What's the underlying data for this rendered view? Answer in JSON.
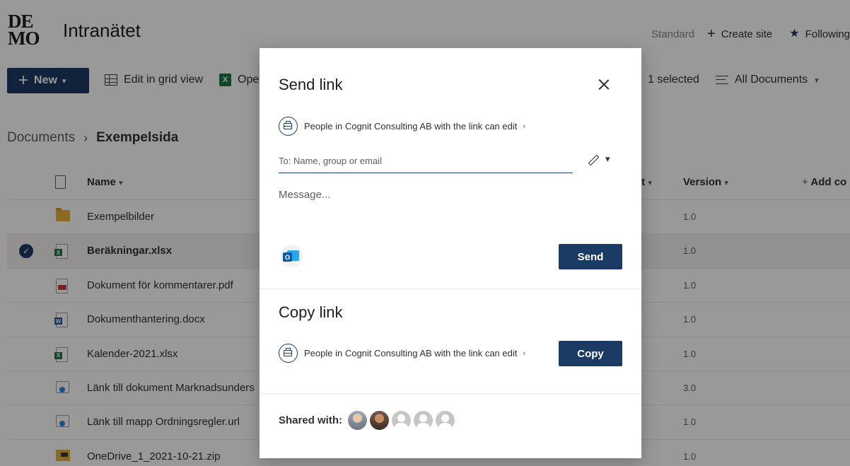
{
  "site": {
    "logo_top": "DE",
    "logo_bottom": "MO",
    "title": "Intranätet",
    "standard": "Standard",
    "create_site": "Create site",
    "following": "Following"
  },
  "commandbar": {
    "new_label": "New",
    "edit_grid": "Edit in grid view",
    "open_partial": "Open",
    "selected": "1 selected",
    "view": "All Documents"
  },
  "breadcrumb": {
    "root": "Documents",
    "current": "Exempelsida"
  },
  "columns": {
    "name": "Name",
    "modified_partial": "nt",
    "version": "Version",
    "add_column_partial": "Add co"
  },
  "rows": [
    {
      "name": "Exempelbilder",
      "version": "1.0",
      "type": "folder"
    },
    {
      "name": "Beräkningar.xlsx",
      "version": "1.0",
      "type": "xlsx",
      "selected": true
    },
    {
      "name": "Dokument för kommentarer.pdf",
      "version": "1.0",
      "type": "pdf"
    },
    {
      "name": "Dokumenthantering.docx",
      "version": "1.0",
      "type": "docx"
    },
    {
      "name": "Kalender-2021.xlsx",
      "version": "1.0",
      "type": "xlsx"
    },
    {
      "name": "Länk till dokument Marknadsunders",
      "version": "3.0",
      "type": "url"
    },
    {
      "name": "Länk till mapp Ordningsregler.url",
      "version": "1.0",
      "type": "url"
    },
    {
      "name": "OneDrive_1_2021-10-21.zip",
      "version": "1.0",
      "type": "zip"
    }
  ],
  "dialog": {
    "send_title": "Send link",
    "permission_text": "People in Cognit Consulting AB with the link can edit",
    "to_placeholder": "To: Name, group or email",
    "message_placeholder": "Message...",
    "send_button": "Send",
    "copy_title": "Copy link",
    "copy_button": "Copy",
    "shared_with": "Shared with:"
  },
  "colors": {
    "accent": "#1b3a64",
    "overlay": "rgba(0,0,0,0.4)"
  }
}
